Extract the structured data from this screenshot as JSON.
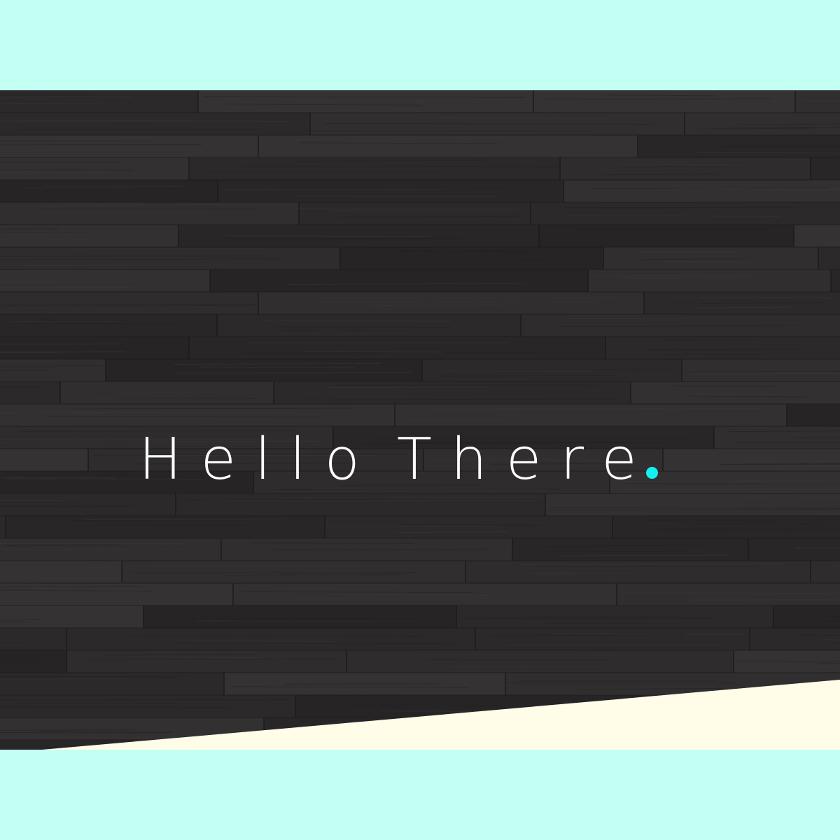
{
  "hero": {
    "headline_word1": "Hello",
    "headline_word2": "There",
    "accent_dot_color": "#14f0f0",
    "background_texture": "dark-wood-planks",
    "wedge_color": "#fffde8"
  },
  "page": {
    "background_color": "#c3fff3"
  },
  "scroll_down": {
    "icon": "arrow-down-icon"
  }
}
